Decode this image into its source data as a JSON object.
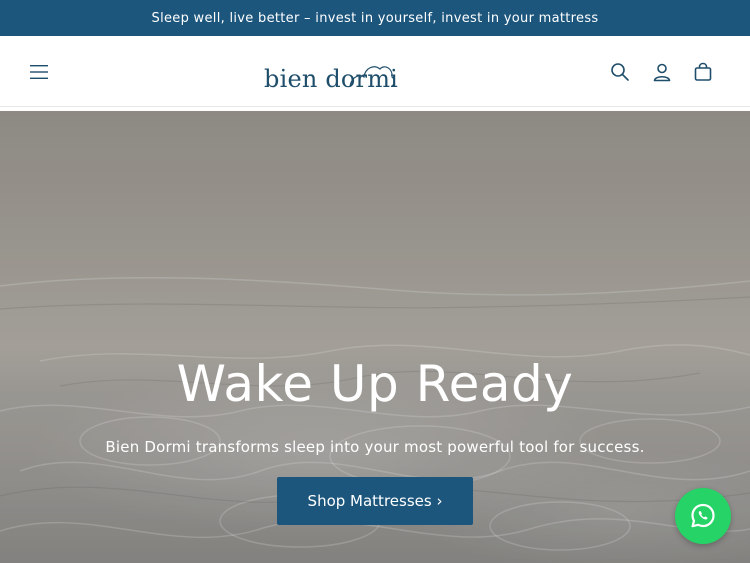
{
  "announcement": {
    "text": "Sleep well, live better – invest in yourself, invest in your mattress"
  },
  "header": {
    "logo_text": "bien dormi",
    "icons": {
      "menu": "hamburger-menu-icon",
      "search": "search-icon",
      "account": "account-icon",
      "cart": "cart-icon"
    }
  },
  "hero": {
    "title": "Wake Up Ready",
    "subtitle": "Bien Dormi transforms sleep into your most powerful tool for success.",
    "cta_label": "Shop Mattresses ›"
  },
  "floating": {
    "whatsapp_icon": "whatsapp-icon"
  },
  "colors": {
    "brand": "#1c567d",
    "logo": "#1f4e6b",
    "whatsapp": "#25d366"
  }
}
